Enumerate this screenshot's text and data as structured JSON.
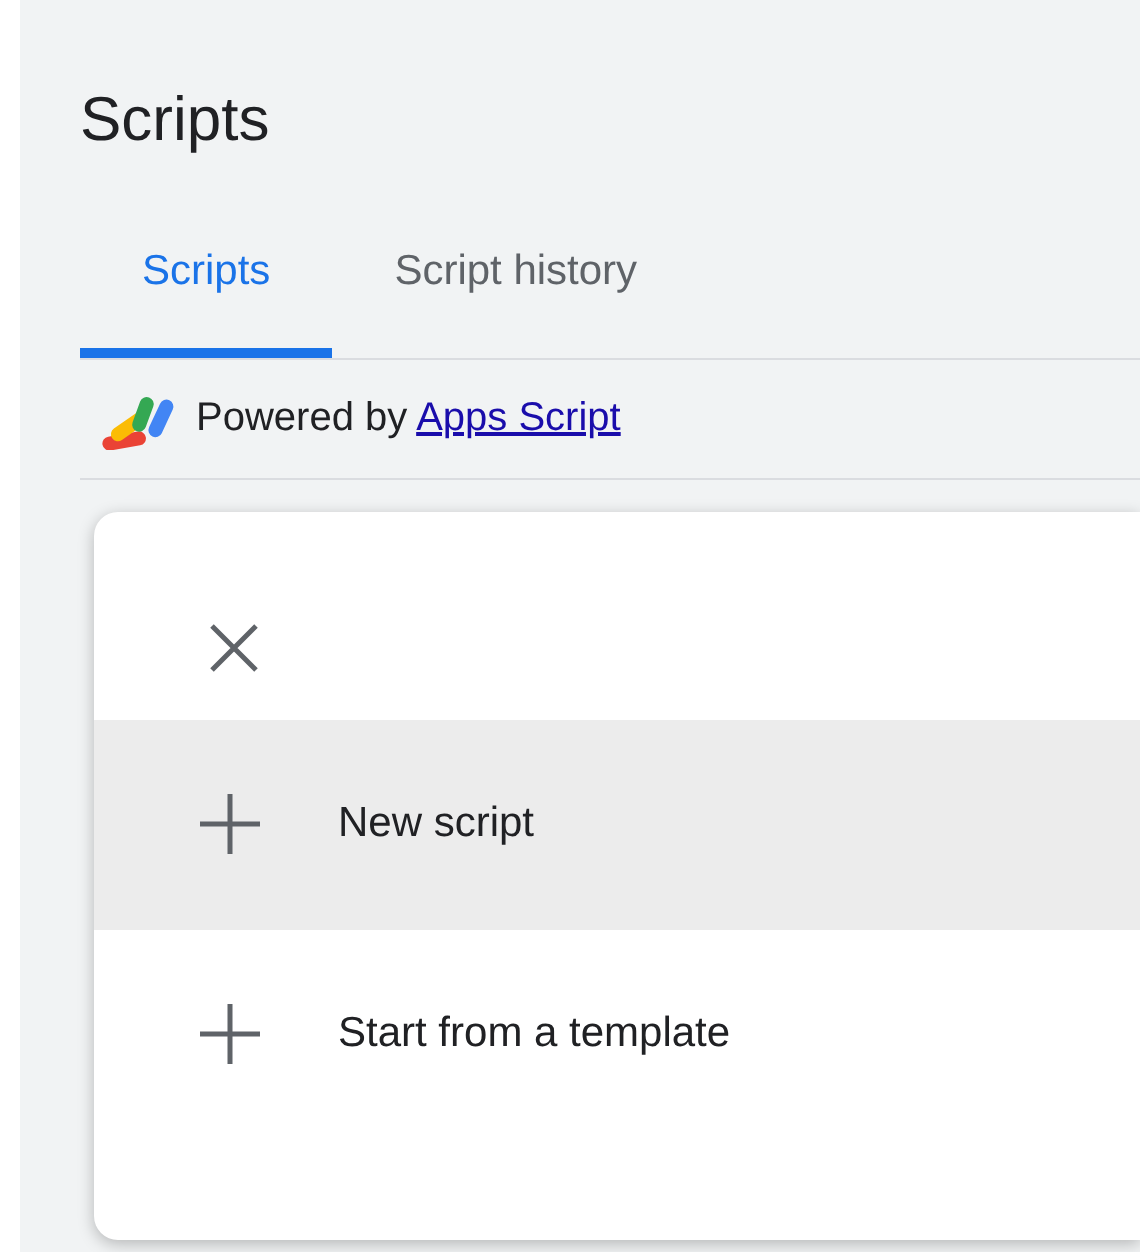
{
  "title": "Scripts",
  "tabs": [
    {
      "label": "Scripts",
      "selected": true
    },
    {
      "label": "Script history",
      "selected": false
    }
  ],
  "powered_by": {
    "text": "Powered by",
    "link": "Apps Script"
  },
  "menu": {
    "items": [
      {
        "label": "New script",
        "selected": true
      },
      {
        "label": "Start from a template",
        "selected": false
      }
    ]
  }
}
